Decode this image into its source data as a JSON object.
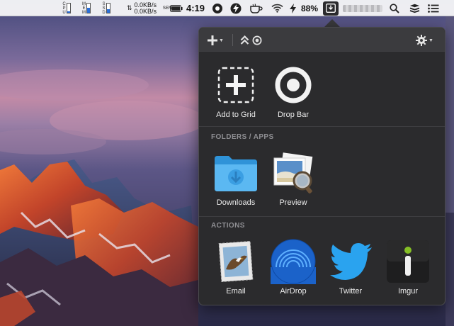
{
  "menubar": {
    "meters": [
      {
        "label": "CPU",
        "letters": [
          "C",
          "P",
          "U"
        ],
        "level": 0.18
      },
      {
        "label": "MEM",
        "letters": [
          "M",
          "E",
          "M"
        ],
        "level": 0.55
      },
      {
        "label": "SSD",
        "letters": [
          "S",
          "S",
          "D"
        ],
        "level": 0.35
      }
    ],
    "net_up": "0.0KB/s",
    "net_down": "0.0KB/s",
    "net_letters": "SEN",
    "clock": "4:19",
    "battery_pct": "88%",
    "icons": [
      "sensor-icon",
      "battery-icon",
      "record-circle-icon",
      "lightning-icon",
      "coffee-cup-icon",
      "wifi-icon",
      "charging-bolt-icon",
      "dropzone-download-icon",
      "spotlight-search-icon",
      "stack-icon",
      "notification-list-icon"
    ]
  },
  "popover": {
    "toolbar": {
      "add_icon": "plus-icon",
      "dropbar_icon": "chevron-up-circle-icon",
      "settings_icon": "gear-icon"
    },
    "top_actions": [
      {
        "label": "Add to Grid",
        "icon": "add-to-grid-icon"
      },
      {
        "label": "Drop Bar",
        "icon": "drop-bar-icon"
      }
    ],
    "folders_title": "FOLDERS / APPS",
    "folders": [
      {
        "label": "Downloads",
        "icon": "downloads-folder-icon"
      },
      {
        "label": "Preview",
        "icon": "preview-app-icon"
      }
    ],
    "actions_title": "ACTIONS",
    "actions": [
      {
        "label": "Email",
        "icon": "email-stamp-icon"
      },
      {
        "label": "AirDrop",
        "icon": "airdrop-icon"
      },
      {
        "label": "Twitter",
        "icon": "twitter-bird-icon"
      },
      {
        "label": "Imgur",
        "icon": "imgur-icon"
      }
    ]
  },
  "colors": {
    "popover_bg": "#2b2b2d",
    "toolbar_bg": "#3b3b3e",
    "section_title": "#8f8f93",
    "airdrop_blue": "#1b6fd8",
    "twitter_blue": "#1da1f2",
    "imgur_green": "#85bf25",
    "folder_blue": "#3fa9f0"
  }
}
